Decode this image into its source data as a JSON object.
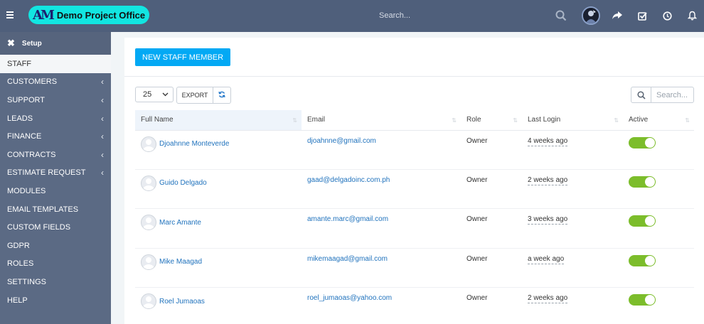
{
  "app": {
    "logo_mark": "AM",
    "title": "Demo Project Office"
  },
  "topbar": {
    "search_placeholder": "Search...",
    "icons": [
      "menu-icon",
      "search-icon",
      "share-icon",
      "checkbox-icon",
      "clock-icon",
      "bell-icon"
    ]
  },
  "sidebar": {
    "setup_label": "Setup",
    "items": [
      {
        "label": "STAFF",
        "active": true,
        "has_chevron": false
      },
      {
        "label": "CUSTOMERS",
        "has_chevron": true
      },
      {
        "label": "SUPPORT",
        "has_chevron": true
      },
      {
        "label": "LEADS",
        "has_chevron": true
      },
      {
        "label": "FINANCE",
        "has_chevron": true
      },
      {
        "label": "CONTRACTS",
        "has_chevron": true
      },
      {
        "label": "ESTIMATE REQUEST",
        "has_chevron": true
      },
      {
        "label": "MODULES",
        "has_chevron": false
      },
      {
        "label": "EMAIL TEMPLATES",
        "has_chevron": false
      },
      {
        "label": "CUSTOM FIELDS",
        "has_chevron": false
      },
      {
        "label": "GDPR",
        "has_chevron": false
      },
      {
        "label": "ROLES",
        "has_chevron": false
      },
      {
        "label": "SETTINGS",
        "has_chevron": false
      },
      {
        "label": "HELP",
        "has_chevron": false
      }
    ]
  },
  "main": {
    "new_staff_label": "NEW STAFF MEMBER",
    "page_size": "25",
    "export_label": "EXPORT",
    "search_placeholder": "Search...",
    "columns": [
      "Full Name",
      "Email",
      "Role",
      "Last Login",
      "Active"
    ],
    "rows": [
      {
        "name": "Djoahnne Monteverde",
        "email": "djoahnne@gmail.com",
        "role": "Owner",
        "last_login": "4 weeks ago",
        "active": true
      },
      {
        "name": "Guido Delgado",
        "email": "gaad@delgadoinc.com.ph",
        "role": "Owner",
        "last_login": "2 weeks ago",
        "active": true
      },
      {
        "name": "Marc Amante",
        "email": "amante.marc@gmail.com",
        "role": "Owner",
        "last_login": "3 weeks ago",
        "active": true
      },
      {
        "name": "Mike Maagad",
        "email": "mikemaagad@gmail.com",
        "role": "Owner",
        "last_login": "a week ago",
        "active": true
      },
      {
        "name": "Roel Jumaoas",
        "email": "roel_jumaoas@yahoo.com",
        "role": "Owner",
        "last_login": "2 weeks ago",
        "active": true
      }
    ]
  },
  "colors": {
    "topbar": "#4f5f7b",
    "sidebar": "#5b6a84",
    "primary_button": "#03a9f4",
    "logo_bg": "#12e5e1",
    "toggle_on": "#7cbd2b",
    "link": "#2173bd"
  }
}
